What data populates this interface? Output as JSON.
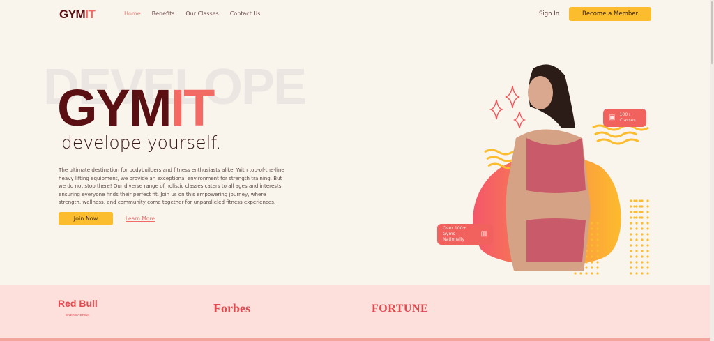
{
  "nav": {
    "logo_a": "GYM",
    "logo_b": "IT",
    "links": [
      "Home",
      "Benefits",
      "Our Classes",
      "Contact Us"
    ],
    "sign_in": "Sign In",
    "member": "Become a Member"
  },
  "hero": {
    "watermark": "DEVELOPE",
    "title_a": "GYM",
    "title_b": "IT",
    "subtitle": "develope yourself.",
    "paragraph": "The ultimate destination for bodybuilders and fitness enthusiasts alike. With top-of-the-line heavy lifting equipment, we provide an exceptional environment for strength training. But we do not stop there! Our diverse range of holistic classes caters to all ages and interests, ensuring everyone finds their perfect fit. Join us on this empowering journey, where strength, wellness, and community come together for unparalleled fitness experiences.",
    "join": "Join Now",
    "learn": "Learn More",
    "badge_classes": [
      "100+",
      "Classes"
    ],
    "badge_gyms": [
      "Over 100+",
      "Gyms Nationally"
    ]
  },
  "brands": {
    "redbull": "Red Bull",
    "redbull_sub": "ENERGY DRINK",
    "forbes": "Forbes",
    "fortune": "FORTUNE"
  }
}
